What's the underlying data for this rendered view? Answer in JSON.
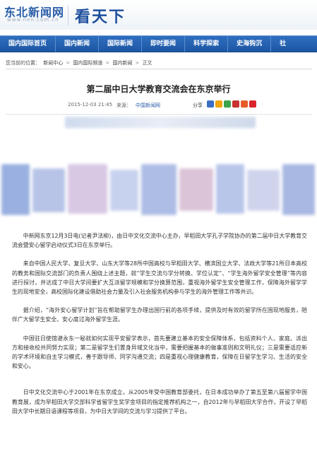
{
  "header": {
    "logo_text": "东北新闻网",
    "logo_sub": "www.nen.com.cn",
    "brand_title": "看天下"
  },
  "nav": {
    "items": [
      "国内国际首页",
      "国内新闻",
      "国际新闻",
      "即时要闻",
      "科学探索",
      "史海钩沉",
      "社"
    ]
  },
  "breadcrumb": {
    "label": "您当前的位置：",
    "items": [
      "新闻中心",
      "国内国际频道",
      "国内新闻",
      "正文"
    ]
  },
  "article": {
    "title": "第二届中日大学教育交流会在东京举行",
    "time": "2015-12-03 21:45",
    "source_label": "来源：",
    "source": "中国新闻网",
    "share_label": "分享",
    "share_icon_colors": [
      "#3b6fc4",
      "#f0a500",
      "#3aa34a",
      "#c8312e",
      "#e45d2a",
      "#d8252b"
    ],
    "paragraphs": [
      "中新网东京12月3日电(记者尹法柳)，由日中文化交流中心主办，早稻田大学孔子学院协办的第二届中日大学教育交流会暨安心留学启动仪式3日在东京举行。",
      "来自中国人民大学、复旦大学、山东大学等28所中国高校与早稻田大学、横滨国立大学、法政大学等21所日本高校的教务和国际交流部门的负责人围绕上述主题，就“学生交流与学分转换、学位认定”、“学生海外留学安全管理”等内容进行探讨，并达成了中日大学间要扩大互派留学规模和学分换算范围，重视海外留学生安全管理工作，保障海外留学学生的现地安全，高校国际化建设借助社会力量及引入社会服务机构参与学生的海外管理工作等共识。",
      "据介绍，“海外安心留学计划”旨在帮助留学生办理出国行前的各项手续，提供及时有效的留学所在国现地服务，陪伴广大留学生安全、安心度过海外留学生涯。",
      "中国驻日使馆谌永东一秘就如何实现平安留学表示，首先要建立基本的安全保障体系，包括资料个人、家庭、派出方和接收校共同努力实现；第二是留学生们置身异域文化当中，需要把握基本的做事准则和文明礼仪；三是需要适应新的学术环境和自主学习模式，善于跟导师、同学沟通交流；四是重视心理健康教育，保障在日留学生学习、生活的安全和安心。",
      "日中文化交流中心于2001年在东京成立，从2005年受中国教育部委托，在日本成功举办了第五至第八届留学中国教育展，成为早稻田大学交部科学省留学生奖学金项目的指定推荐机构之一，自2012年与早稻田大学合作，开设了早稻田大学中长期日语课程等项目，为中日大学间的交流与学习提供了平台。"
    ]
  },
  "colors": {
    "nav_bg": "#1d56a3",
    "brand": "#1d4f9c",
    "source_link": "#2a5ea8"
  }
}
